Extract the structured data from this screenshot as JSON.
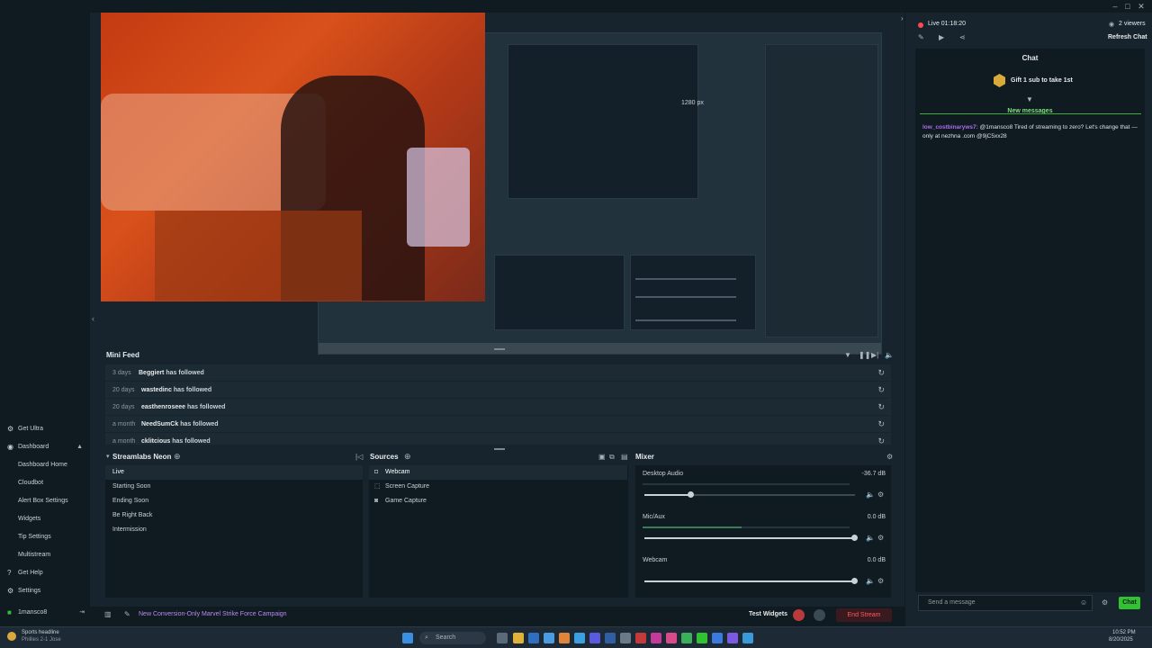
{
  "topbar": {
    "live_time": "Live 01:18:20",
    "viewers": "2 viewers",
    "refresh_chat": "Refresh Chat"
  },
  "sidebar": {
    "items": [
      {
        "label": "Get Ultra"
      },
      {
        "label": "Dashboard"
      },
      {
        "label": "Dashboard Home"
      },
      {
        "label": "Cloudbot"
      },
      {
        "label": "Alert Box Settings"
      },
      {
        "label": "Widgets"
      },
      {
        "label": "Tip Settings"
      },
      {
        "label": "Multistream"
      },
      {
        "label": "Get Help"
      },
      {
        "label": "Settings"
      }
    ],
    "username": "1mansco8"
  },
  "preview": {
    "nested_width_label": "1280 px"
  },
  "minifeed": {
    "title": "Mini Feed",
    "rows": [
      {
        "time": "3 days",
        "user": "Beggiert",
        "action": "has followed"
      },
      {
        "time": "20 days",
        "user": "wastedinc",
        "action": "has followed"
      },
      {
        "time": "20 days",
        "user": "easthenroseee",
        "action": "has followed"
      },
      {
        "time": "a month",
        "user": "NeedSumCk",
        "action": "has followed"
      },
      {
        "time": "a month",
        "user": "cklitcious",
        "action": "has followed"
      }
    ]
  },
  "scenes": {
    "title": "Streamlabs Neon",
    "items": [
      "Live",
      "Starting Soon",
      "Ending Soon",
      "Be Right Back",
      "Intermission"
    ]
  },
  "sources": {
    "title": "Sources",
    "items": [
      "Webcam",
      "Screen Capture",
      "Game Capture"
    ]
  },
  "mixer": {
    "title": "Mixer",
    "channels": [
      {
        "name": "Desktop Audio",
        "db": "-36.7 dB",
        "level": 0.22
      },
      {
        "name": "Mic/Aux",
        "db": "0.0 dB",
        "level": 1.0
      },
      {
        "name": "Webcam",
        "db": "0.0 dB",
        "level": 1.0
      }
    ]
  },
  "bottombar": {
    "campaign": "New Conversion-Only Marvel Strike Force Campaign",
    "test_widgets": "Test Widgets",
    "end_stream": "End Stream"
  },
  "chat": {
    "title": "Chat",
    "gift": "Gift 1 sub to take 1st",
    "new_messages": "New messages",
    "message_user": "low_costbinaryws7:",
    "message_text": "@1mansco8 Tired of streaming to zero? Let's change that — only at nezhna .com @9jC5xx28",
    "input_placeholder": "Send a message",
    "send_label": "Chat"
  },
  "taskbar": {
    "weather": "Sports headline",
    "weather_sub": "Phillies 2-1 Jose",
    "search": "Search",
    "time": "10:52 PM",
    "date": "8/20/2025"
  },
  "colors": {
    "accent_green": "#31c231",
    "live_red": "#ff4b4b",
    "purple": "#b06cf0"
  }
}
